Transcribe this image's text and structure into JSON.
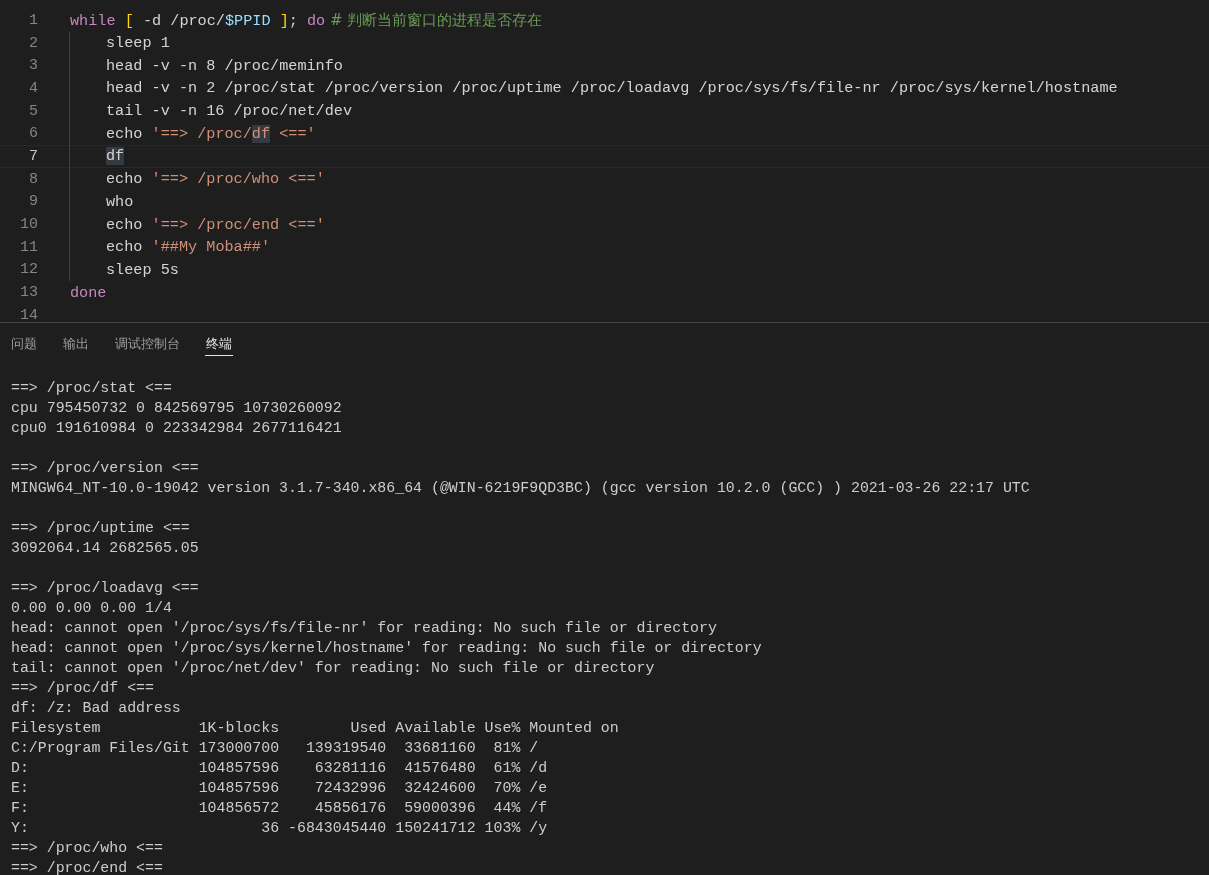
{
  "editor": {
    "lines": [
      {
        "number": "1",
        "indented": false,
        "current": false,
        "tokens": [
          {
            "kind": "keyword",
            "text": "while"
          },
          {
            "kind": "bracket",
            "text": " ["
          },
          {
            "kind": "text",
            "text": " -d /proc/"
          },
          {
            "kind": "variable",
            "text": "$PPID"
          },
          {
            "kind": "bracket",
            "text": " ]"
          },
          {
            "kind": "text",
            "text": "; "
          },
          {
            "kind": "keyword",
            "text": "do"
          },
          {
            "kind": "comment",
            "text": " # 判断当前窗口的进程是否存在"
          }
        ]
      },
      {
        "number": "2",
        "indented": true,
        "current": false,
        "tokens": [
          {
            "kind": "text",
            "text": "sleep 1"
          }
        ]
      },
      {
        "number": "3",
        "indented": true,
        "current": false,
        "tokens": [
          {
            "kind": "text",
            "text": "head -v -n 8 /proc/meminfo"
          }
        ]
      },
      {
        "number": "4",
        "indented": true,
        "current": false,
        "tokens": [
          {
            "kind": "text",
            "text": "head -v -n 2 /proc/stat /proc/version /proc/uptime /proc/loadavg /proc/sys/fs/file-nr /proc/sys/kernel/hostname"
          }
        ]
      },
      {
        "number": "5",
        "indented": true,
        "current": false,
        "tokens": [
          {
            "kind": "text",
            "text": "tail -v -n 16 /proc/net/dev"
          }
        ]
      },
      {
        "number": "6",
        "indented": true,
        "current": false,
        "tokens": [
          {
            "kind": "text",
            "text": "echo "
          },
          {
            "kind": "string",
            "text": "'==> /proc/"
          },
          {
            "kind": "string",
            "text": "df",
            "highlighted": true
          },
          {
            "kind": "string",
            "text": " <=='"
          }
        ]
      },
      {
        "number": "7",
        "indented": true,
        "current": true,
        "tokens": [
          {
            "kind": "text",
            "text": "df",
            "highlighted": true
          }
        ]
      },
      {
        "number": "8",
        "indented": true,
        "current": false,
        "tokens": [
          {
            "kind": "text",
            "text": "echo "
          },
          {
            "kind": "string",
            "text": "'==> /proc/who <=='"
          }
        ]
      },
      {
        "number": "9",
        "indented": true,
        "current": false,
        "tokens": [
          {
            "kind": "text",
            "text": "who"
          }
        ]
      },
      {
        "number": "10",
        "indented": true,
        "current": false,
        "tokens": [
          {
            "kind": "text",
            "text": "echo "
          },
          {
            "kind": "string",
            "text": "'==> /proc/end <=='"
          }
        ]
      },
      {
        "number": "11",
        "indented": true,
        "current": false,
        "tokens": [
          {
            "kind": "text",
            "text": "echo "
          },
          {
            "kind": "string",
            "text": "'##My Moba##'"
          }
        ]
      },
      {
        "number": "12",
        "indented": true,
        "current": false,
        "tokens": [
          {
            "kind": "text",
            "text": "sleep 5s"
          }
        ]
      },
      {
        "number": "13",
        "indented": false,
        "current": false,
        "tokens": [
          {
            "kind": "keyword",
            "text": "done"
          }
        ]
      },
      {
        "number": "14",
        "indented": false,
        "current": false
      }
    ]
  },
  "panel_tabs": [
    {
      "label": "问题",
      "selected": false
    },
    {
      "label": "输出",
      "selected": false
    },
    {
      "label": "调试控制台",
      "selected": false
    },
    {
      "label": "终端",
      "selected": true
    }
  ],
  "terminal": {
    "blocks": [
      [
        "==> /proc/stat <==",
        "cpu 795450732 0 842569795 10730260092",
        "cpu0 191610984 0 223342984 2677116421"
      ],
      [
        "==> /proc/version <==",
        "MINGW64_NT-10.0-19042 version 3.1.7-340.x86_64 (@WIN-6219F9QD3BC) (gcc version 10.2.0 (GCC) ) 2021-03-26 22:17 UTC"
      ],
      [
        "==> /proc/uptime <==",
        "3092064.14 2682565.05"
      ],
      [
        "==> /proc/loadavg <==",
        "0.00 0.00 0.00 1/4",
        "head: cannot open '/proc/sys/fs/file-nr' for reading: No such file or directory",
        "head: cannot open '/proc/sys/kernel/hostname' for reading: No such file or directory",
        "tail: cannot open '/proc/net/dev' for reading: No such file or directory",
        "==> /proc/df <==",
        "df: /z: Bad address",
        "Filesystem           1K-blocks        Used Available Use% Mounted on",
        "C:/Program Files/Git 173000700   139319540  33681160  81% /",
        "D:                   104857596    63281116  41576480  61% /d",
        "E:                   104857596    72432996  32424600  70% /e",
        "F:                   104856572    45856176  59000396  44% /f",
        "Y:                          36 -6843045440 150241712 103% /y",
        "==> /proc/who <==",
        "==> /proc/end <=="
      ]
    ]
  }
}
